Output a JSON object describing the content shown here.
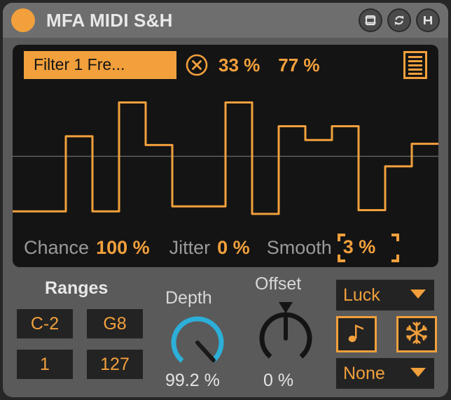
{
  "titlebar": {
    "power_led": "power-led",
    "title": "MFA MIDI S&H",
    "icons": [
      {
        "name": "device-rack-icon",
        "label": "Device"
      },
      {
        "name": "refresh-sync-icon",
        "label": "Reload"
      },
      {
        "name": "floppy-save-icon",
        "label": "Save"
      }
    ]
  },
  "display": {
    "target": "Filter 1 Fre...",
    "clear_icon": "circle-x-icon",
    "range_min_pct": "33 %",
    "range_max_pct": "77 %",
    "menu_icon": "list-menu-icon",
    "footer": {
      "chance_label": "Chance",
      "chance_value": "100 %",
      "jitter_label": "Jitter",
      "jitter_value": "0 %",
      "smooth_label": "Smooth",
      "smooth_value": "3 %"
    }
  },
  "chart_data": {
    "type": "line",
    "title": "Sample & Hold step waveform",
    "xlabel": "",
    "ylabel": "",
    "ylim": [
      0,
      1
    ],
    "grid": false,
    "centerline": 0.5,
    "interpolation": "step",
    "color": "#f2a03c",
    "background": "#141414",
    "x": [
      0,
      1,
      2,
      3,
      4,
      5,
      6,
      7,
      8,
      9,
      10,
      11,
      12,
      13,
      14,
      15
    ],
    "values": [
      0.06,
      0.06,
      0.66,
      0.06,
      0.93,
      0.59,
      0.1,
      0.1,
      0.93,
      0.04,
      0.74,
      0.63,
      0.74,
      0.07,
      0.42,
      0.6
    ]
  },
  "controls": {
    "ranges": {
      "title": "Ranges",
      "note_low": "C-2",
      "note_high": "G8",
      "vel_low": "1",
      "vel_high": "127"
    },
    "depth": {
      "label": "Depth",
      "value": "99.2 %",
      "fraction": 0.992,
      "color": "#2cafd8"
    },
    "offset": {
      "label": "Offset",
      "value": "0 %",
      "fraction": 0.5,
      "color": "#141414"
    },
    "mode_dropdown": {
      "value": "Luck",
      "arrow_icon": "chevron-down-icon"
    },
    "sync_dropdown": {
      "value": "None",
      "arrow_icon": "chevron-down-icon"
    },
    "toggles": [
      {
        "name": "note-toggle",
        "icon": "music-note-icon",
        "active": true
      },
      {
        "name": "freeze-toggle",
        "icon": "snowflake-icon",
        "active": true
      }
    ]
  }
}
